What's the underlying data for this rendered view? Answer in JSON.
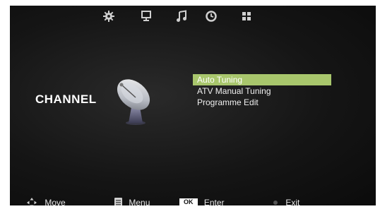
{
  "top_menu": {
    "icons": [
      "picture-settings-icon",
      "monitor-icon",
      "music-note-icon",
      "clock-icon",
      "grid-icon"
    ],
    "active": "picture-settings-icon"
  },
  "section": {
    "title": "CHANNEL",
    "icon": "satellite-dish-icon"
  },
  "menu": {
    "items": [
      {
        "label": "Auto Tuning",
        "selected": true
      },
      {
        "label": "ATV Manual Tuning",
        "selected": false
      },
      {
        "label": "Programme Edit",
        "selected": false
      }
    ]
  },
  "footer": {
    "move": "Move",
    "menu": "Menu",
    "ok_key": "OK",
    "enter": "Enter",
    "exit": "Exit"
  },
  "colors": {
    "highlight": "#a8c66c",
    "background": "#151515",
    "text": "#ffffff"
  }
}
